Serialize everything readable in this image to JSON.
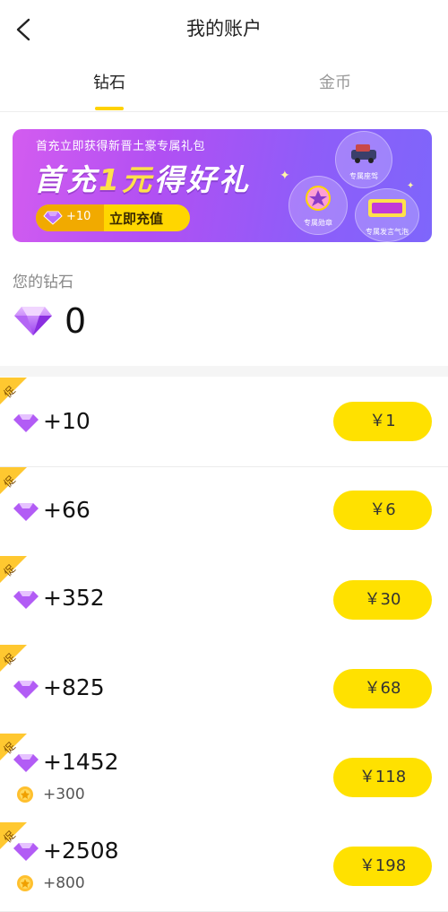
{
  "header": {
    "title": "我的账户"
  },
  "tabs": [
    {
      "label": "钻石",
      "active": true
    },
    {
      "label": "金币",
      "active": false
    }
  ],
  "banner": {
    "subtitle": "首充立即获得新晋土豪专属礼包",
    "title_prefix": "首充",
    "title_accent": "1元",
    "title_suffix": "得好礼",
    "pill_amount": "+10",
    "pill_cta": "立即充值",
    "rewards": [
      {
        "label": "专属座驾",
        "icon": "car-icon"
      },
      {
        "label": "专属勋章",
        "icon": "badge-icon"
      },
      {
        "label": "专属发言气泡",
        "icon": "chat-bubble-icon"
      }
    ]
  },
  "balance": {
    "label": "您的钻石",
    "value": "0"
  },
  "packages": [
    {
      "promo": "促",
      "amount": "+10",
      "price": "￥1",
      "bonus": null
    },
    {
      "promo": "促",
      "amount": "+66",
      "price": "￥6",
      "bonus": null
    },
    {
      "promo": "促",
      "amount": "+352",
      "price": "￥30",
      "bonus": null
    },
    {
      "promo": "促",
      "amount": "+825",
      "price": "￥68",
      "bonus": null
    },
    {
      "promo": "促",
      "amount": "+1452",
      "price": "￥118",
      "bonus": "+300"
    },
    {
      "promo": "促",
      "amount": "+2508",
      "price": "￥198",
      "bonus": "+800"
    }
  ],
  "colors": {
    "accent": "#ffe100",
    "gem": "#a24bf0",
    "banner_start": "#d35cf0",
    "banner_end": "#7e66fb",
    "promo": "#ffc830"
  }
}
